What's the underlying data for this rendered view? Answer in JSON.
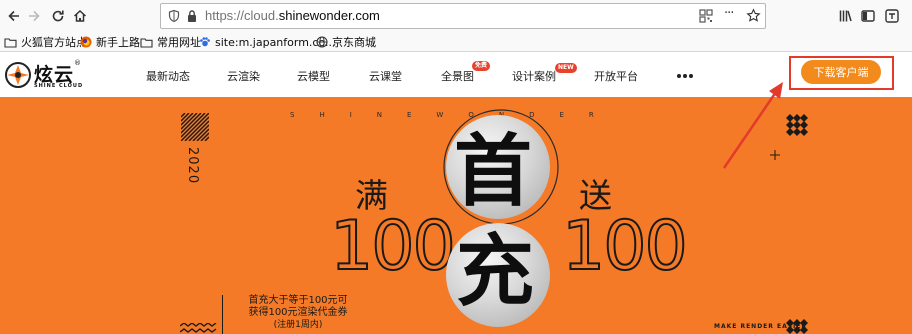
{
  "browser": {
    "url_scheme": "https://cloud.",
    "url_domain": "shinewonder.com",
    "url_rest": "",
    "more_label": "···"
  },
  "bookmarks": [
    {
      "label": "火狐官方站点"
    },
    {
      "label": "新手上路"
    },
    {
      "label": "常用网址"
    },
    {
      "label": "site:m.japanform.co..."
    },
    {
      "label": "京东商城"
    }
  ],
  "site": {
    "logo_text": "炫云",
    "logo_reg": "®",
    "logo_sub": "SHINE CLOUD",
    "nav": [
      {
        "label": "最新动态"
      },
      {
        "label": "云渲染"
      },
      {
        "label": "云模型"
      },
      {
        "label": "云课堂"
      },
      {
        "label": "全景图",
        "badge": "免费"
      },
      {
        "label": "设计案例",
        "badge": "NEW"
      },
      {
        "label": "开放平台"
      }
    ],
    "download_button": "下载客户端"
  },
  "banner": {
    "top_text": "SHINEWONDER",
    "year": "2020",
    "left_word": "满",
    "right_word": "送",
    "left_number": "100",
    "right_number": "100",
    "sphere_top": "首",
    "sphere_bottom": "充",
    "promo_line1": "首充大于等于100元可",
    "promo_line2": "获得100元渲染代金券",
    "promo_line3": "(注册1周内)",
    "tagline": "MAKE RENDER EASIER",
    "accent_color": "#f47a27",
    "highlight_color": "#e33a2c",
    "button_color": "#f28a1c"
  }
}
